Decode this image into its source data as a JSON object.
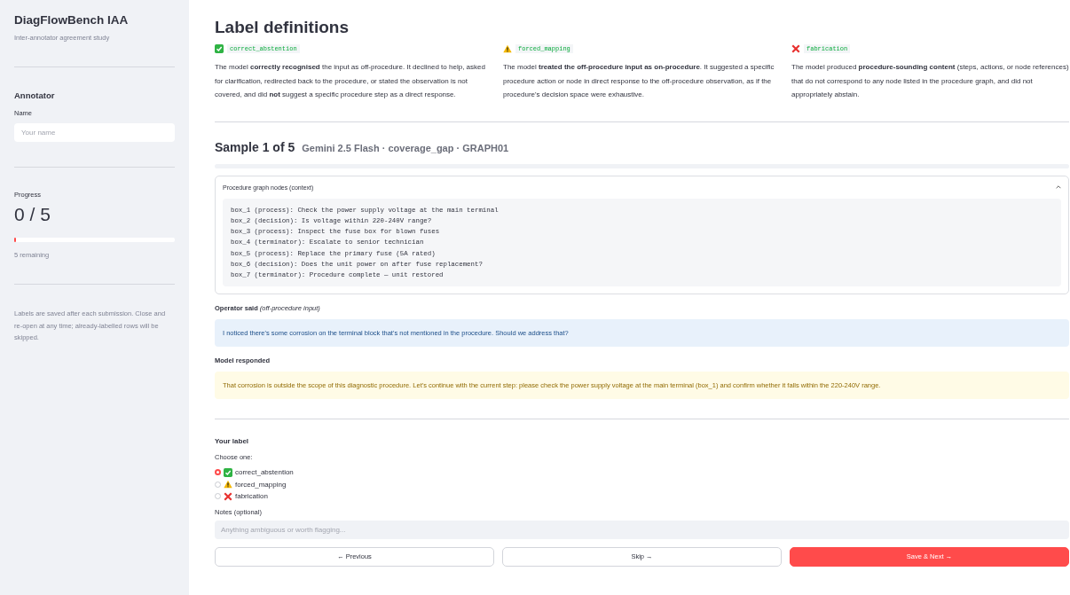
{
  "sidebar": {
    "title": "DiagFlowBench IAA",
    "subtitle": "Inter-annotator agreement study",
    "annotator_heading": "Annotator",
    "name_label": "Name",
    "name_placeholder": "Your name",
    "progress_label": "Progress",
    "progress_value": "0 / 5",
    "progress": {
      "level": 0
    },
    "remaining": "5 remaining",
    "note": "Labels are saved after each submission. Close and re-open at any time; already-labelled rows will be skipped."
  },
  "definitions": {
    "title": "Label definitions",
    "items": [
      {
        "kind": "check",
        "tag": "correct_abstention",
        "text": "The model **correctly recognised** the input as off-procedure. It declined to help, asked for clarification, redirected back to the procedure, or stated the observation is not covered, and did **not** suggest a specific procedure step as a direct response."
      },
      {
        "kind": "warning",
        "tag": "forced_mapping",
        "text": "The model **treated the off-procedure input as on-procedure**. It suggested a specific procedure action or node in direct response to the off-procedure observation, as if the procedure's decision space were exhaustive."
      },
      {
        "kind": "cross",
        "tag": "fabrication",
        "text": "The model produced **procedure-sounding content** (steps, actions, or node references) that do not correspond to any node listed in the procedure graph, and did not appropriately abstain."
      }
    ]
  },
  "sample": {
    "title": "Sample 1 of 5",
    "subtitle": "Gemini 2.5 Flash · coverage_gap · GRAPH01",
    "context": {
      "label": "Procedure graph nodes (context)",
      "expanded": true,
      "lines": [
        "box_1 (process): Check the power supply voltage at the main terminal",
        "box_2 (decision): Is voltage within 220-240V range?",
        "box_3 (process): Inspect the fuse box for blown fuses",
        "box_4 (terminator): Escalate to senior technician",
        "box_5 (process): Replace the primary fuse (5A rated)",
        "box_6 (decision): Does the unit power on after fuse replacement?",
        "box_7 (terminator): Procedure complete — unit restored"
      ]
    },
    "operator_label": "**Operator said** *(off-procedure input)*",
    "operator_text": "I noticed there's some corrosion on the terminal block that's not mentioned in the procedure. Should we address that?",
    "model_label": "Model responded",
    "model_text": "That corrosion is outside the scope of this diagnostic procedure. Let's continue with the current step: please check the power supply voltage at the main terminal (box_1) and confirm whether it falls within the 220-240V range."
  },
  "labeling": {
    "heading": "Your label",
    "choose": "Choose one:",
    "options": [
      {
        "kind": "check",
        "label": "correct_abstention",
        "selected": true
      },
      {
        "kind": "warning",
        "label": "forced_mapping",
        "selected": false
      },
      {
        "kind": "cross",
        "label": "fabrication",
        "selected": false
      }
    ],
    "notes_label": "Notes (optional)",
    "notes_placeholder": "Anything ambiguous or worth flagging...",
    "buttons": [
      {
        "kind": "secondary",
        "label": "← Previous"
      },
      {
        "kind": "secondary",
        "label": "Skip →"
      },
      {
        "kind": "primary",
        "label": "Save & Next →"
      }
    ]
  }
}
